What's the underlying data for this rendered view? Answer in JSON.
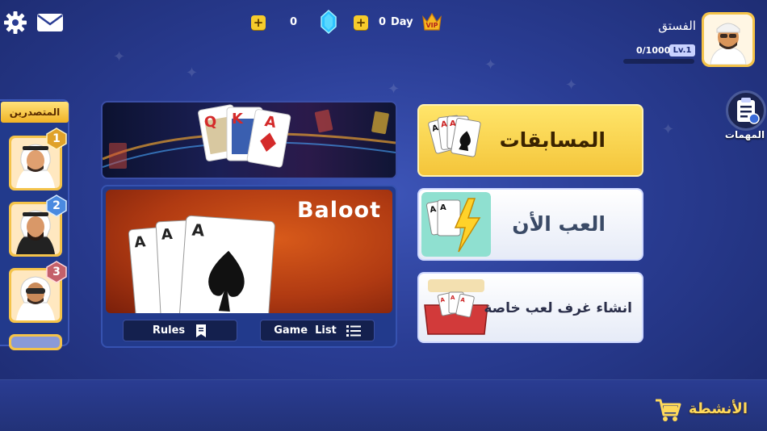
{
  "topbar": {
    "settings_icon": "gear-icon",
    "mail_icon": "mail-icon",
    "coins": "0",
    "day_count": "0",
    "day_label": "Day",
    "vip_icon": "vip-crown-icon"
  },
  "profile": {
    "name": "الفستق",
    "xp": "0/1000",
    "level": "Lv.1",
    "level_progress": 0
  },
  "tasks": {
    "label": "المهمات",
    "icon": "clipboard-icon"
  },
  "leaderboard": {
    "title": "المتصدرين",
    "ranks": [
      "1",
      "2",
      "3"
    ]
  },
  "banner": {
    "cards": [
      "Q",
      "K",
      "A"
    ]
  },
  "baloot": {
    "title": "Baloot",
    "rules_label": "Rules",
    "game_list_label": "Game  List"
  },
  "menu": {
    "competitions": "المسابقات",
    "play_now": "العب الأن",
    "private_rooms": "انشاء غرف لعب خاصة"
  },
  "activities": {
    "label": "الأنشطة",
    "icon": "cart-icon"
  },
  "colors": {
    "background": "#2a3d94",
    "gold": "#f4c34a",
    "accent_yellow": "#ffe56a",
    "baloot_red": "#b03a12"
  }
}
